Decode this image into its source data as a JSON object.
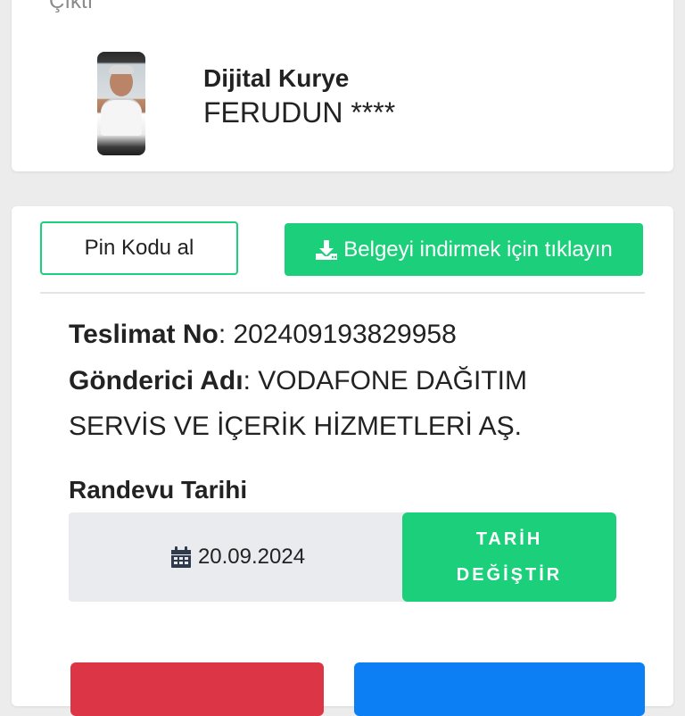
{
  "header": {
    "cut_text": "Çıktı"
  },
  "courier": {
    "title": "Dijital Kurye",
    "name": "FERUDUN ****"
  },
  "actions": {
    "pin_button": "Pin Kodu al",
    "download_button": "Belgeyi indirmek için tıklayın"
  },
  "delivery": {
    "tracking_label": "Teslimat No",
    "tracking_value": "202409193829958",
    "sender_label": "Gönderici Adı",
    "sender_value": "VODAFONE DAĞITIM SERVİS VE İÇERİK HİZMETLERİ AŞ."
  },
  "appointment": {
    "label": "Randevu Tarihi",
    "date": "20.09.2024",
    "change_button_line1": "TARİH",
    "change_button_line2": "DEĞİŞTİR"
  },
  "icons": {
    "download": "download-icon",
    "calendar": "calendar-icon"
  },
  "colors": {
    "accent_green": "#1ccf7a",
    "danger_red": "#dc3545",
    "primary_blue": "#0d7ff5",
    "date_box_bg": "#e9ebee"
  }
}
